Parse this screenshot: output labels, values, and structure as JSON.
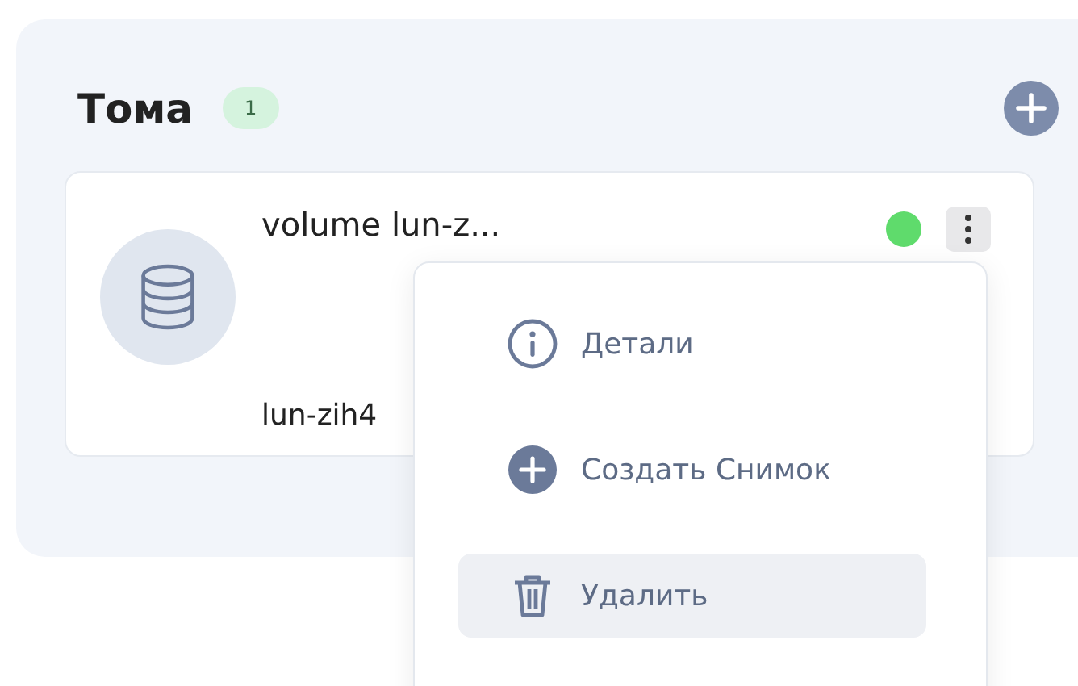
{
  "section": {
    "title": "Тома",
    "count": "1"
  },
  "volumes": [
    {
      "name": "volume lun-z...",
      "subtitle": "lun-zih4",
      "color": "#5fdb6c"
    }
  ],
  "menu": {
    "items": [
      {
        "kind": "info",
        "label": "Детали",
        "selected": false
      },
      {
        "kind": "plus",
        "label": "Создать Снимок",
        "selected": false
      },
      {
        "kind": "trash",
        "label": "Удалить",
        "selected": true
      }
    ]
  }
}
